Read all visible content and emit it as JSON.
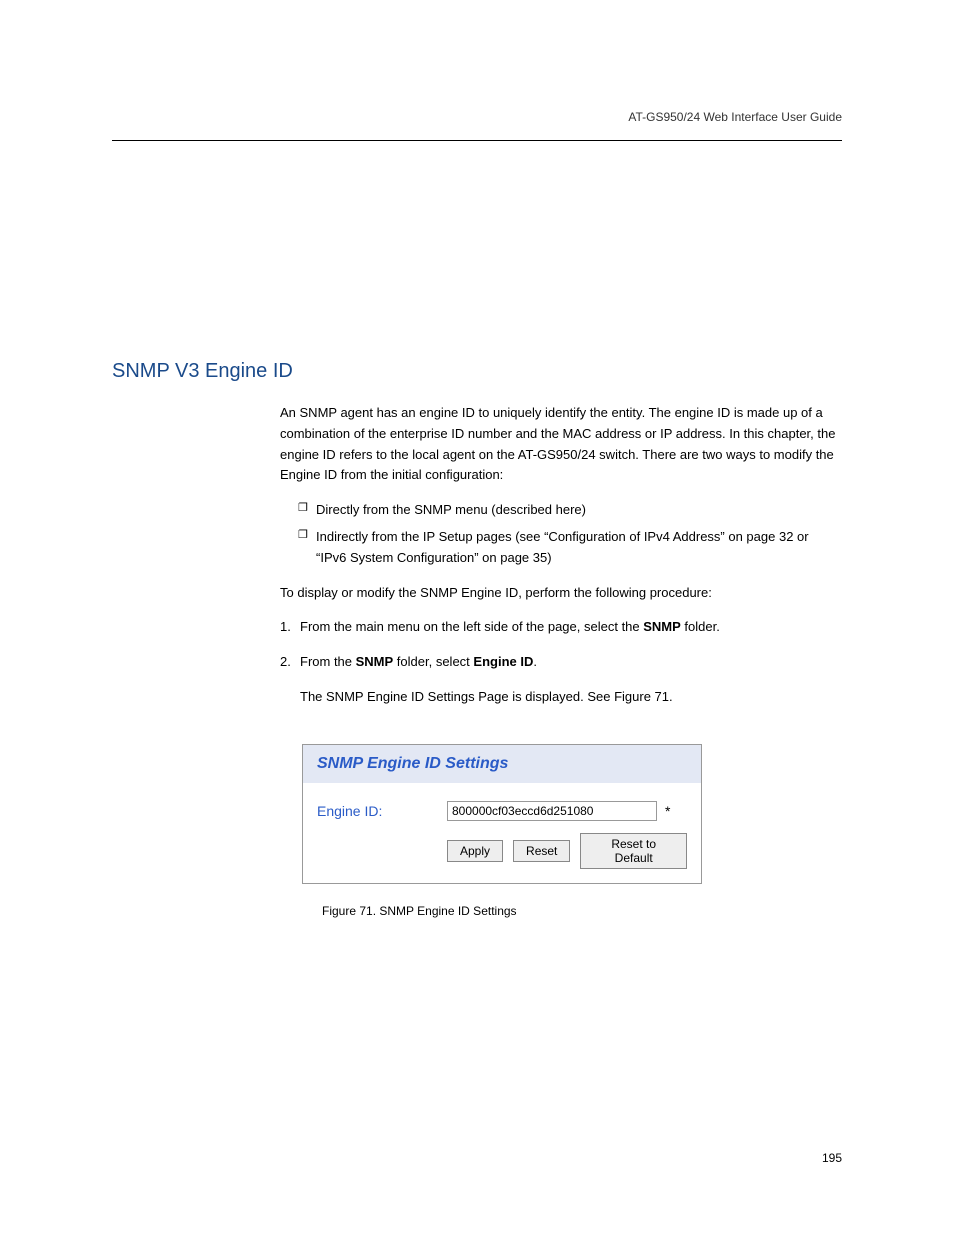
{
  "running_header": "AT-GS950/24 Web Interface User Guide",
  "section": {
    "title": "SNMP V3 Engine ID",
    "intro": "An SNMP agent has an engine ID to uniquely identify the entity. The engine ID is made up of a combination of the enterprise ID number and the MAC address or IP address. In this chapter, the engine ID refers to the local agent on the AT-GS950/24 switch. There are two ways to modify the Engine ID from the initial configuration:",
    "bullets": [
      "Directly from the SNMP menu (described here)",
      "Indirectly from the IP Setup pages (see “Configuration of IPv4 Address” on page 32 or “IPv6 System Configuration” on page 35)"
    ],
    "steps_intro": "To display or modify the SNMP Engine ID, perform the following procedure:",
    "steps": [
      {
        "num": "1.",
        "text_prefix": "From the main menu on the left side of the page, select the ",
        "menu": "SNMP",
        "text_suffix": " folder."
      },
      {
        "num": "2.",
        "text_prefix": "From the ",
        "menu": "SNMP",
        "text_mid": " folder, select ",
        "menu2": "Engine ID",
        "text_suffix2": ".",
        "followup": "The SNMP Engine ID Settings Page is displayed. See Figure 71."
      }
    ]
  },
  "figure": {
    "panel_title": "SNMP Engine ID Settings",
    "label": "Engine ID:",
    "input_value": "800000cf03eccd6d251080",
    "asterisk": "*",
    "buttons": {
      "apply": "Apply",
      "reset": "Reset",
      "reset_default": "Reset to Default"
    },
    "caption": "Figure 71. SNMP Engine ID Settings"
  },
  "page_number": "195"
}
